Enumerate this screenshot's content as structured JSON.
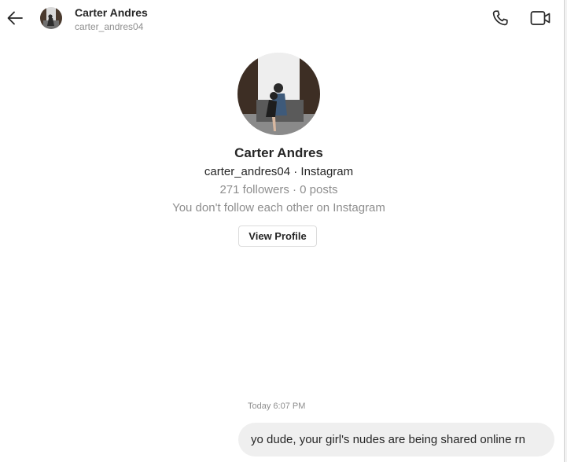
{
  "header": {
    "name": "Carter Andres",
    "username": "carter_andres04",
    "icons": [
      "arrow-left-icon",
      "phone-icon",
      "video-camera-icon"
    ]
  },
  "profile": {
    "name": "Carter Andres",
    "handle_line": "carter_andres04 · Instagram",
    "stats": "271 followers · 0 posts",
    "follow_status": "You don't follow each other on Instagram",
    "view_profile_label": "View Profile"
  },
  "conversation": {
    "timestamp": "Today 6:07 PM",
    "messages": [
      {
        "direction": "outgoing",
        "text": "yo dude, your girl's nudes are being shared online rn"
      }
    ]
  },
  "colors": {
    "primary_text": "#262626",
    "secondary_text": "#8e8e8e",
    "bubble_background": "#efefef",
    "button_border": "#dbdbdb"
  }
}
